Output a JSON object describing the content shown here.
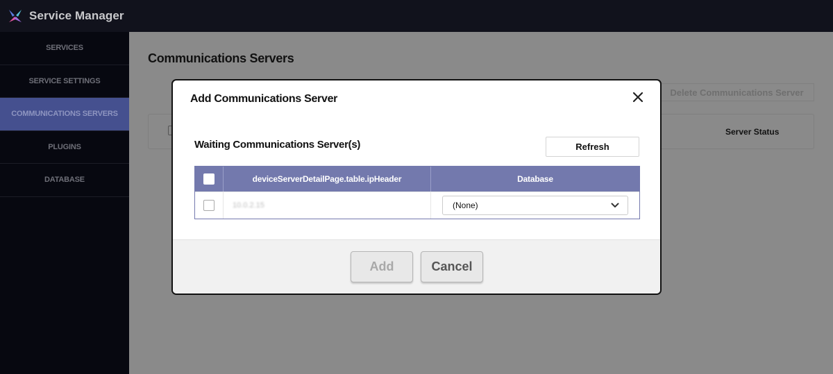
{
  "app": {
    "title": "Service Manager"
  },
  "sidebar": {
    "items": [
      {
        "label": "SERVICES",
        "active": false
      },
      {
        "label": "SERVICE SETTINGS",
        "active": false
      },
      {
        "label": "COMMUNICATIONS SERVERS",
        "active": true
      },
      {
        "label": "PLUGINS",
        "active": false
      },
      {
        "label": "DATABASE",
        "active": false
      }
    ]
  },
  "page": {
    "title": "Communications Servers",
    "delete_button": "Delete Communications Server",
    "table": {
      "status_header": "Server Status"
    }
  },
  "modal": {
    "title": "Add Communications Server",
    "section_title": "Waiting Communications Server(s)",
    "refresh_label": "Refresh",
    "table": {
      "ip_header": "deviceServerDetailPage.table.ipHeader",
      "db_header": "Database",
      "rows": [
        {
          "ip": "10.0.2.15",
          "database": "(None)",
          "checked": false
        }
      ]
    },
    "add_label": "Add",
    "cancel_label": "Cancel"
  },
  "colors": {
    "topbar": "#11121c",
    "sidebar": "#070810",
    "sidebar_active": "#45508f",
    "table_header": "#7379ad",
    "overlay": "#8a8a8a"
  },
  "icons": {
    "logo": "service-manager-logo",
    "close": "close-icon",
    "dropdown": "chevron-down-icon"
  }
}
